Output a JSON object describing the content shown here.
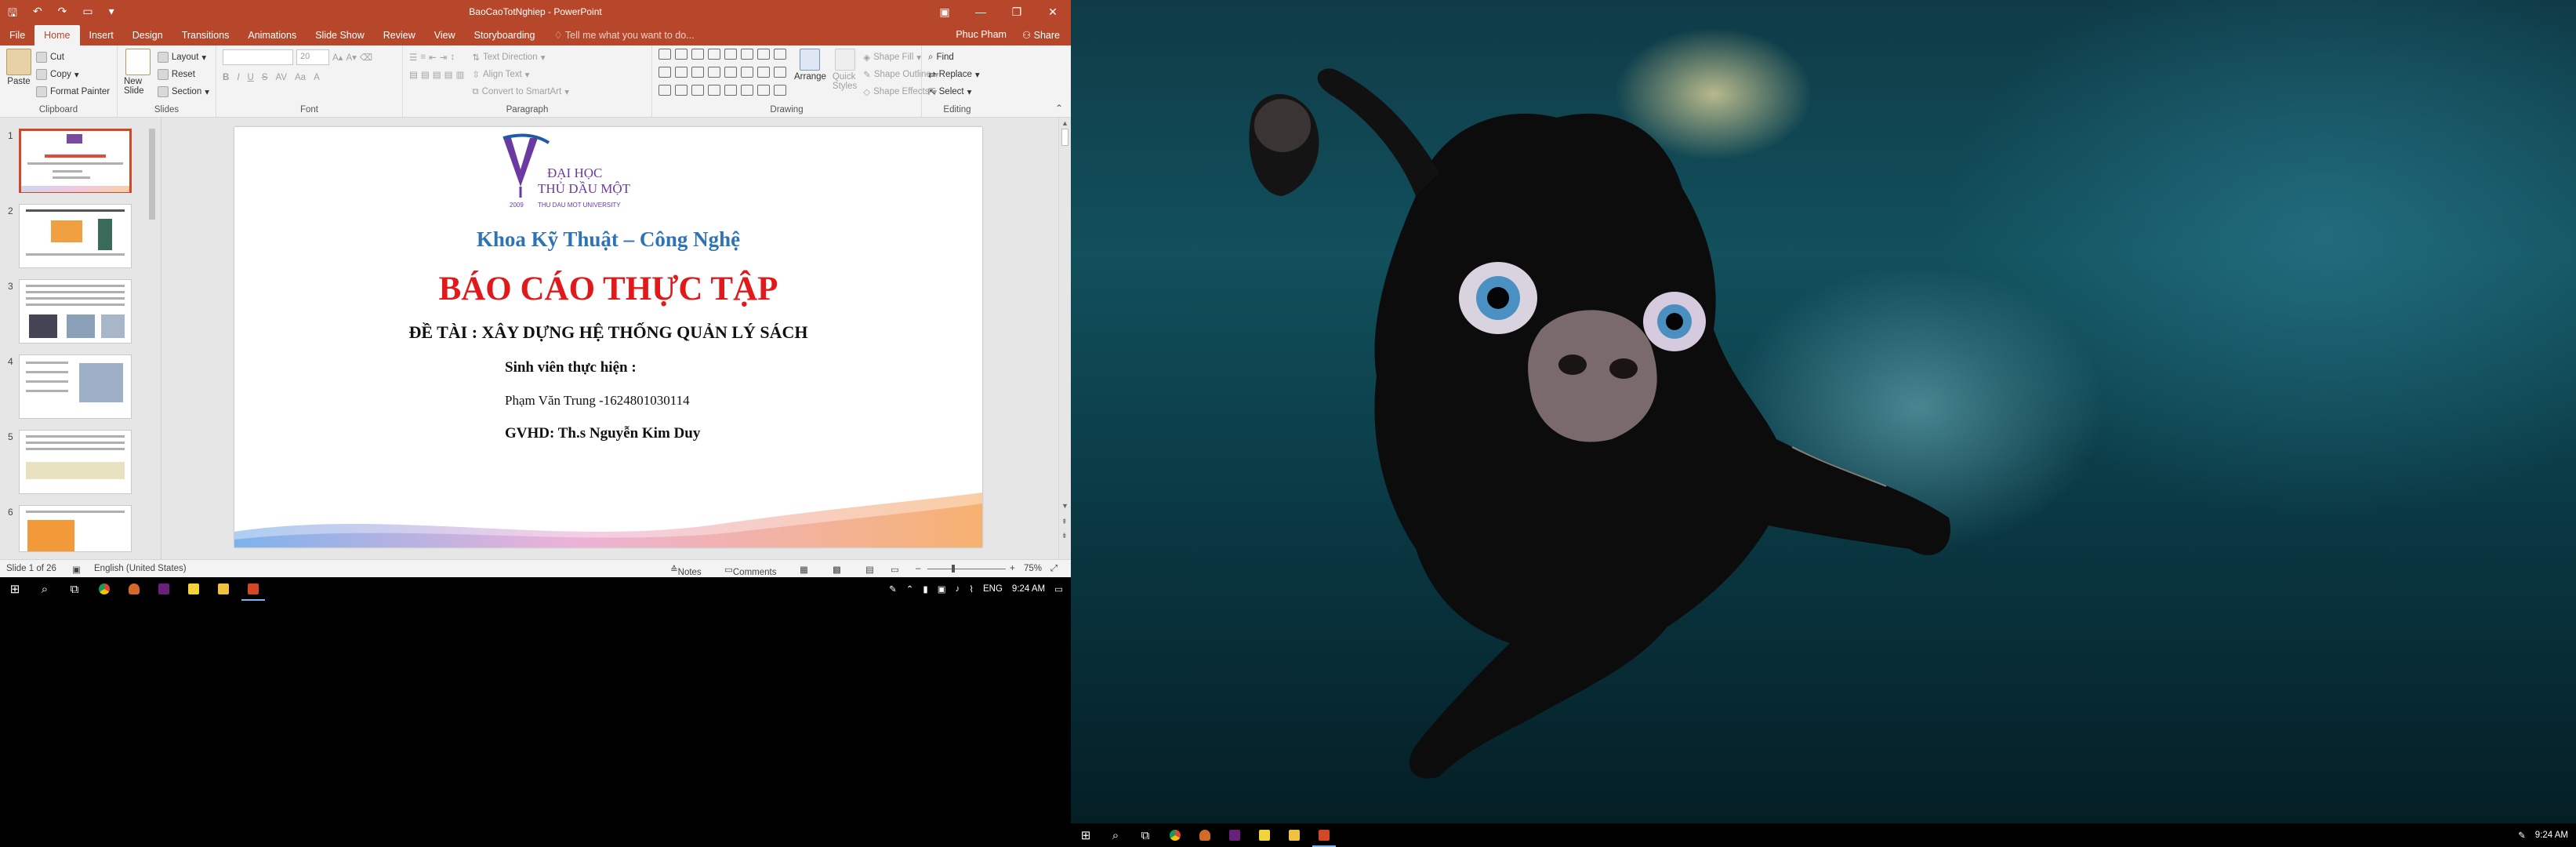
{
  "powerpoint": {
    "window_title": "BaoCaoTotNghiep - PowerPoint",
    "tabs": [
      "File",
      "Home",
      "Insert",
      "Design",
      "Transitions",
      "Animations",
      "Slide Show",
      "Review",
      "View",
      "Storyboarding"
    ],
    "active_tab": "Home",
    "tell_me": "Tell me what you want to do...",
    "user_name": "Phuc Pham",
    "share_label": "Share",
    "ribbon": {
      "clipboard": {
        "paste": "Paste",
        "cut": "Cut",
        "copy": "Copy",
        "format_painter": "Format Painter",
        "label": "Clipboard"
      },
      "slides": {
        "new_slide": "New Slide",
        "layout": "Layout",
        "reset": "Reset",
        "section": "Section",
        "label": "Slides"
      },
      "font": {
        "size_value": "20",
        "label": "Font",
        "bold": "B",
        "italic": "I",
        "underline": "U",
        "strike": "S"
      },
      "paragraph": {
        "text_direction": "Text Direction",
        "align_text": "Align Text",
        "convert_smartart": "Convert to SmartArt",
        "label": "Paragraph"
      },
      "drawing": {
        "arrange": "Arrange",
        "quick_styles": "Quick Styles",
        "shape_fill": "Shape Fill",
        "shape_outline": "Shape Outline",
        "shape_effects": "Shape Effects",
        "label": "Drawing"
      },
      "editing": {
        "find": "Find",
        "replace": "Replace",
        "select": "Select",
        "label": "Editing"
      }
    },
    "thumbnails": [
      "1",
      "2",
      "3",
      "4",
      "5",
      "6"
    ],
    "slide": {
      "logo_line1": "ĐẠI HỌC",
      "logo_line2": "THỦ DẦU MỘT",
      "logo_year": "2009",
      "logo_sub": "THU DAU MOT UNIVERSITY",
      "khoa": "Khoa Kỹ Thuật – Công Nghệ",
      "title": "BÁO CÁO THỰC TẬP",
      "topic": "ĐỀ TÀI : XÂY DỰNG HỆ THỐNG QUẢN LÝ SÁCH",
      "sinh_vien_label": "Sinh viên thực hiện :",
      "student": "Phạm Văn Trung  -1624801030114",
      "gvhd": "GVHD: Th.s Nguyễn Kim Duy"
    },
    "status": {
      "slide_count": "Slide 1 of 26",
      "language": "English (United States)",
      "notes": "Notes",
      "comments": "Comments",
      "zoom": "75%",
      "zoom_level": 0.33
    }
  },
  "taskbar_left": {
    "language": "ENG",
    "time": "9:24 AM"
  },
  "taskbar_right": {
    "time": "9:24 AM"
  },
  "colors": {
    "ppt_accent": "#b7472a",
    "slide_title": "#e01a1a",
    "slide_khoa": "#2e74b5"
  }
}
